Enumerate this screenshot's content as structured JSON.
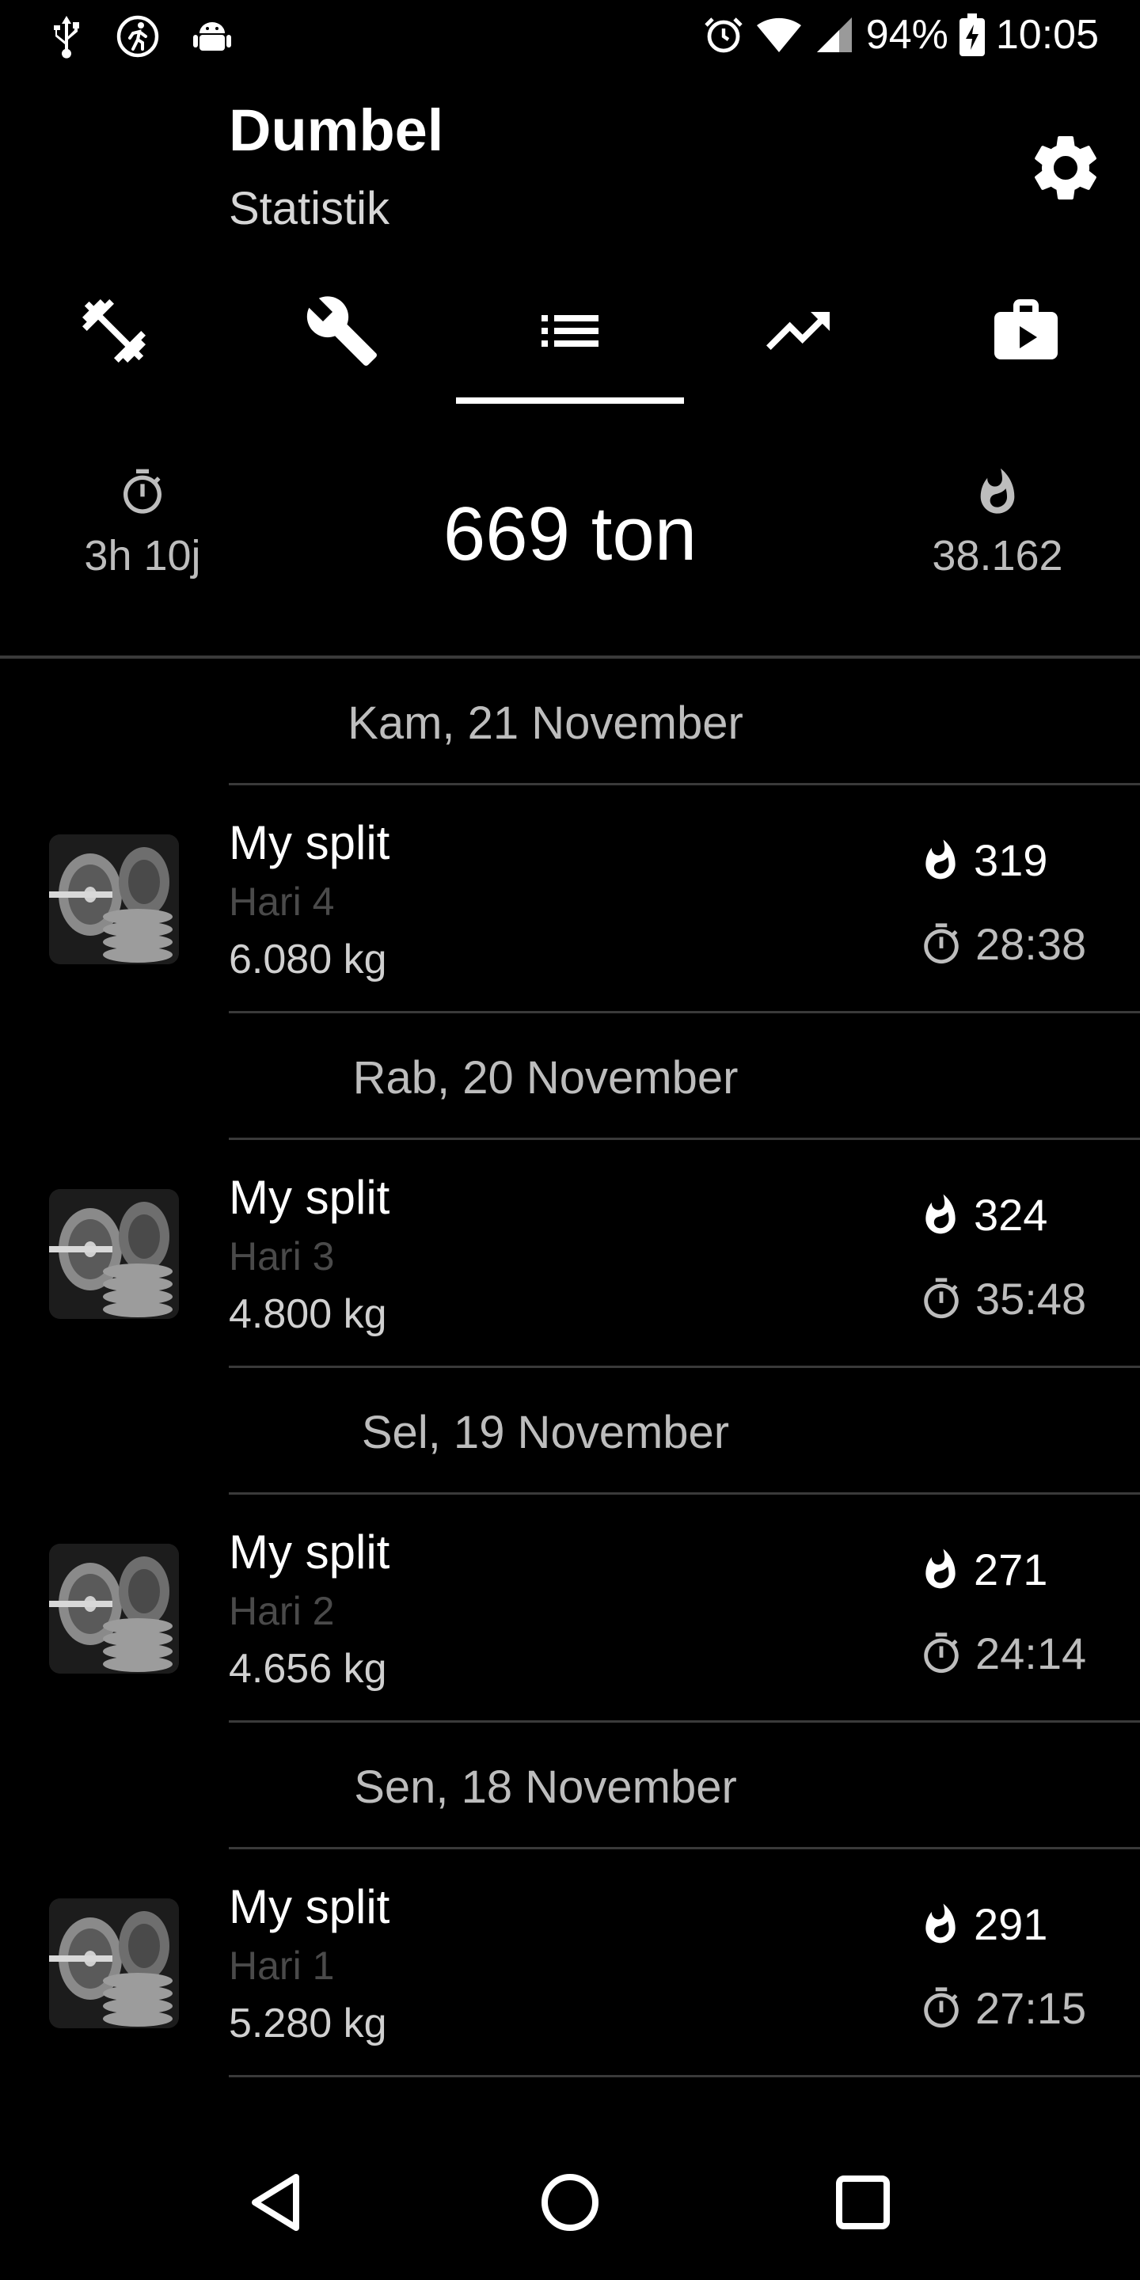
{
  "status_bar": {
    "battery": "94%",
    "time": "10:05",
    "left_icons": [
      "usb-icon",
      "running-icon",
      "android-icon"
    ],
    "right_icons": [
      "alarm-icon",
      "wifi-icon",
      "signal-icon",
      "battery-charging-icon"
    ]
  },
  "header": {
    "title": "Dumbel",
    "subtitle": "Statistik",
    "settings_icon": "gear-icon"
  },
  "tabs": [
    {
      "icon": "dumbbell-icon",
      "selected": false
    },
    {
      "icon": "wrench-icon",
      "selected": false
    },
    {
      "icon": "list-icon",
      "selected": true
    },
    {
      "icon": "trending-up-icon",
      "selected": false
    },
    {
      "icon": "briefcase-play-icon",
      "selected": false
    }
  ],
  "summary": {
    "total_time": "3h 10j",
    "total_weight": "669 ton",
    "total_calories": "38.162"
  },
  "workouts": [
    {
      "date": "Kam, 21 November",
      "name": "My split",
      "day": "Hari 4",
      "weight": "6.080 kg",
      "calories": "319",
      "duration": "28:38"
    },
    {
      "date": "Rab, 20 November",
      "name": "My split",
      "day": "Hari 3",
      "weight": "4.800 kg",
      "calories": "324",
      "duration": "35:48"
    },
    {
      "date": "Sel, 19 November",
      "name": "My split",
      "day": "Hari 2",
      "weight": "4.656 kg",
      "calories": "271",
      "duration": "24:14"
    },
    {
      "date": "Sen, 18 November",
      "name": "My split",
      "day": "Hari 1",
      "weight": "5.280 kg",
      "calories": "291",
      "duration": "27:15"
    }
  ],
  "colors": {
    "background": "#000000",
    "text_primary": "#ffffff",
    "text_secondary": "#bdbdbd",
    "text_muted": "#4a4a4a",
    "divider": "#3a3a3a"
  }
}
